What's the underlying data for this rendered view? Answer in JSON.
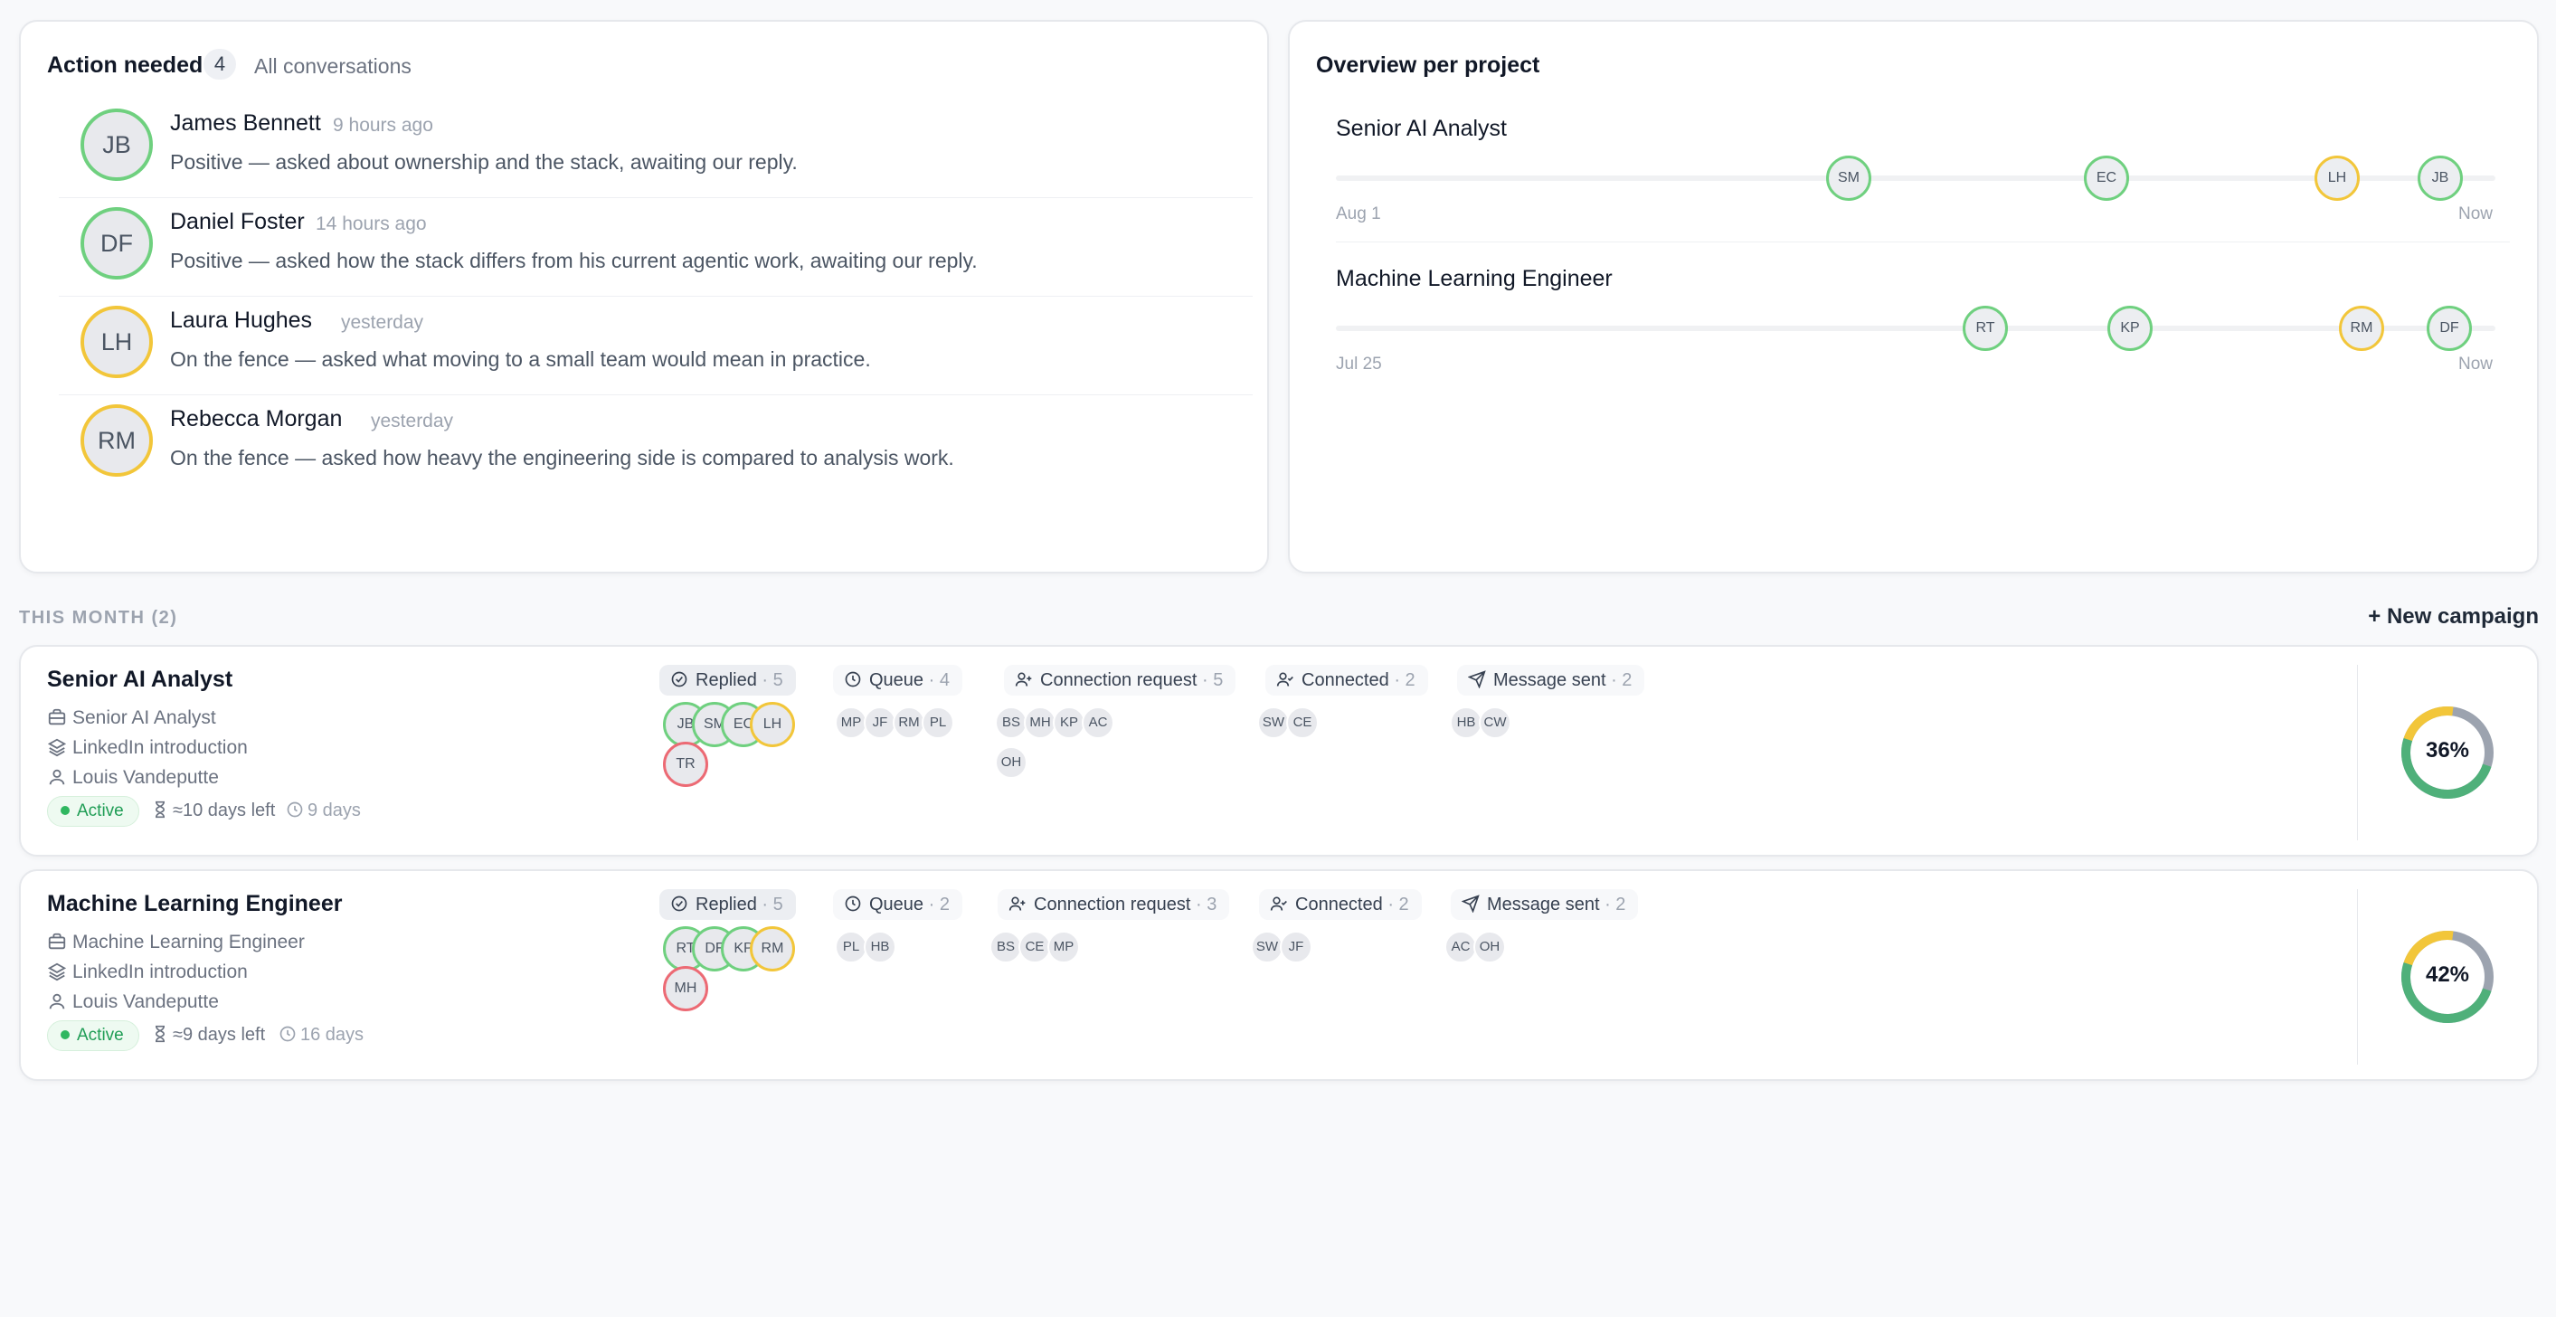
{
  "action": {
    "title": "Action needed",
    "count": "4",
    "all_link": "All conversations",
    "items": [
      {
        "initials": "JB",
        "name": "James Bennett",
        "time": "9 hours ago",
        "text": "Positive — asked about ownership and the stack, awaiting our reply.",
        "sentiment": "green"
      },
      {
        "initials": "DF",
        "name": "Daniel Foster",
        "time": "14 hours ago",
        "text": "Positive — asked how the stack differs from his current agentic work, awaiting our reply.",
        "sentiment": "green"
      },
      {
        "initials": "LH",
        "name": "Laura Hughes",
        "time": "yesterday",
        "text": "On the fence — asked what moving to a small team would mean in practice.",
        "sentiment": "yellow"
      },
      {
        "initials": "RM",
        "name": "Rebecca Morgan",
        "time": "yesterday",
        "text": "On the fence — asked how heavy the engineering side is compared to analysis work.",
        "sentiment": "yellow"
      }
    ]
  },
  "overview": {
    "title": "Overview per project",
    "projects": [
      {
        "name": "Senior AI Analyst",
        "start": "Aug 1",
        "end": "Now",
        "dots": [
          {
            "initials": "SM",
            "color": "green"
          },
          {
            "initials": "EC",
            "color": "green"
          },
          {
            "initials": "LH",
            "color": "yellow"
          },
          {
            "initials": "JB",
            "color": "green"
          }
        ]
      },
      {
        "name": "Machine Learning Engineer",
        "start": "Jul 25",
        "end": "Now",
        "dots": [
          {
            "initials": "RT",
            "color": "green"
          },
          {
            "initials": "KP",
            "color": "green"
          },
          {
            "initials": "RM",
            "color": "yellow"
          },
          {
            "initials": "DF",
            "color": "green"
          }
        ]
      }
    ]
  },
  "section": {
    "label": "THIS MONTH (2)",
    "new_campaign": "+ New campaign"
  },
  "campaigns": [
    {
      "title": "Senior AI Analyst",
      "role": "Senior AI Analyst",
      "channel": "LinkedIn introduction",
      "owner": "Louis Vandeputte",
      "status": "Active",
      "days_left": "≈10 days left",
      "duration": "9 days",
      "percent": "36%",
      "stages": [
        {
          "label": "Replied",
          "count": "· 5",
          "chips": [
            "JB",
            "SM",
            "EC",
            "LH",
            "TR"
          ]
        },
        {
          "label": "Queue",
          "count": "· 4",
          "chips": [
            "MP",
            "JF",
            "RM",
            "PL"
          ]
        },
        {
          "label": "Connection request",
          "count": "· 5",
          "chips": [
            "BS",
            "MH",
            "KP",
            "AC",
            "OH"
          ]
        },
        {
          "label": "Connected",
          "count": "· 2",
          "chips": [
            "SW",
            "CE"
          ]
        },
        {
          "label": "Message sent",
          "count": "· 2",
          "chips": [
            "HB",
            "CW"
          ]
        }
      ]
    },
    {
      "title": "Machine Learning Engineer",
      "role": "Machine Learning Engineer",
      "channel": "LinkedIn introduction",
      "owner": "Louis Vandeputte",
      "status": "Active",
      "days_left": "≈9 days left",
      "duration": "16 days",
      "percent": "42%",
      "stages": [
        {
          "label": "Replied",
          "count": "· 5",
          "chips": [
            "RT",
            "DF",
            "KP",
            "RM",
            "MH"
          ]
        },
        {
          "label": "Queue",
          "count": "· 2",
          "chips": [
            "PL",
            "HB"
          ]
        },
        {
          "label": "Connection request",
          "count": "· 3",
          "chips": [
            "BS",
            "CE",
            "MP"
          ]
        },
        {
          "label": "Connected",
          "count": "· 2",
          "chips": [
            "SW",
            "JF"
          ]
        },
        {
          "label": "Message sent",
          "count": "· 2",
          "chips": [
            "AC",
            "OH"
          ]
        }
      ]
    }
  ],
  "colors": {
    "green": "#6fd07f",
    "yellow": "#f2c63a",
    "red": "#ec6a74",
    "gray": "#9ca3af",
    "donut_green": "#4fb07a"
  }
}
